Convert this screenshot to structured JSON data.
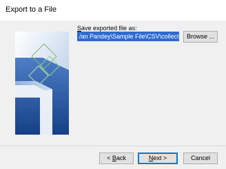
{
  "window": {
    "title": "Export to a File"
  },
  "form": {
    "save_label_underlined": "S",
    "save_label_rest": "ave exported file as:",
    "path_value": "/an Pandey\\Sample File\\CSV\\collected.csv",
    "browse_label": "Browse ..."
  },
  "footer": {
    "back_prefix": "< ",
    "back_underlined": "B",
    "back_rest": "ack",
    "next_underlined": "N",
    "next_rest": "ext >",
    "cancel_label": "Cancel"
  },
  "colors": {
    "selection": "#2f6ad0",
    "default_button_border": "#0078d7"
  }
}
